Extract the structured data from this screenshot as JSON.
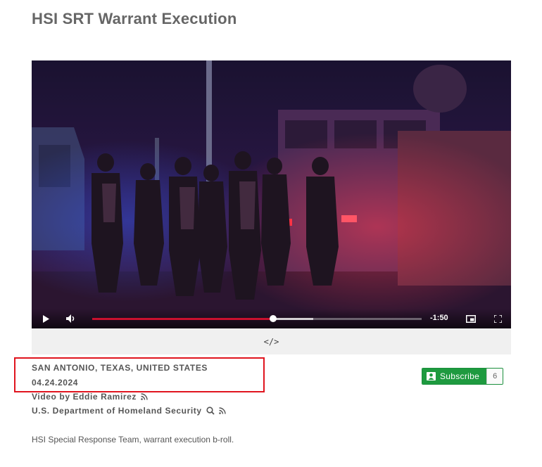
{
  "page": {
    "title": "HSI SRT Warrant Execution"
  },
  "player": {
    "time_remaining": "-1:50",
    "progress_percent": 55,
    "buffered_percent": 67
  },
  "embed": {
    "label": "</>"
  },
  "meta": {
    "location": "SAN ANTONIO, TEXAS, UNITED STATES",
    "date": "04.24.2024",
    "video_by": "Video by Eddie Ramirez",
    "agency": "U.S. Department of Homeland Security"
  },
  "subscribe": {
    "label": "Subscribe",
    "count": "6"
  },
  "description": "HSI Special Response Team, warrant execution b-roll.",
  "colors": {
    "accent_red": "#c8102e",
    "subscribe_green": "#1e9a3f",
    "highlight_red": "#e0141e"
  },
  "icons": {
    "rss": "rss-icon",
    "search": "search-icon",
    "play": "play-icon",
    "volume": "volume-icon",
    "pip": "picture-in-picture-icon",
    "fullscreen": "fullscreen-icon"
  }
}
